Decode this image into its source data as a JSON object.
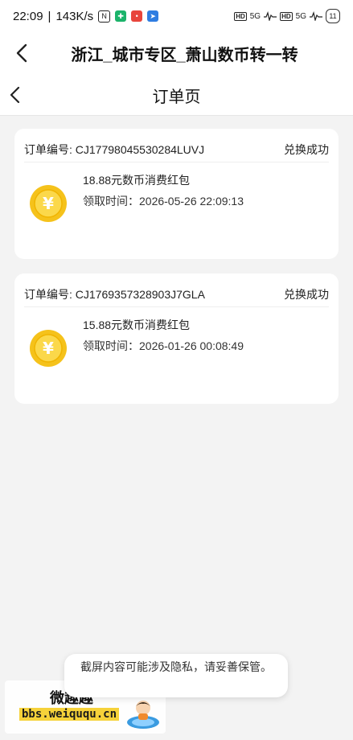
{
  "statusbar": {
    "time": "22:09",
    "speed": "143K/s",
    "network": "5G",
    "battery": "11"
  },
  "appbar": {
    "title": "浙江_城市专区_萧山数币转一转"
  },
  "page": {
    "title": "订单页"
  },
  "orders": [
    {
      "order_label": "订单编号: CJ17798045530284LUVJ",
      "status": "兑换成功",
      "name": "18.88元数币消费红包",
      "time": "领取时间：2026-05-26 22:09:13"
    },
    {
      "order_label": "订单编号: CJ1769357328903J7GLA",
      "status": "兑换成功",
      "name": "15.88元数币消费红包",
      "time": "领取时间：2026-01-26 00:08:49"
    }
  ],
  "coin_symbol": "¥",
  "toast": {
    "text": "截屏内容可能涉及隐私，请妥善保管。"
  },
  "watermark": {
    "title": "微趣趣",
    "url": "bbs.weiququ.cn"
  },
  "colors": {
    "coin_outer": "#f5c21b",
    "coin_inner": "#fbd84a",
    "page_bg": "#f3f3f3"
  }
}
